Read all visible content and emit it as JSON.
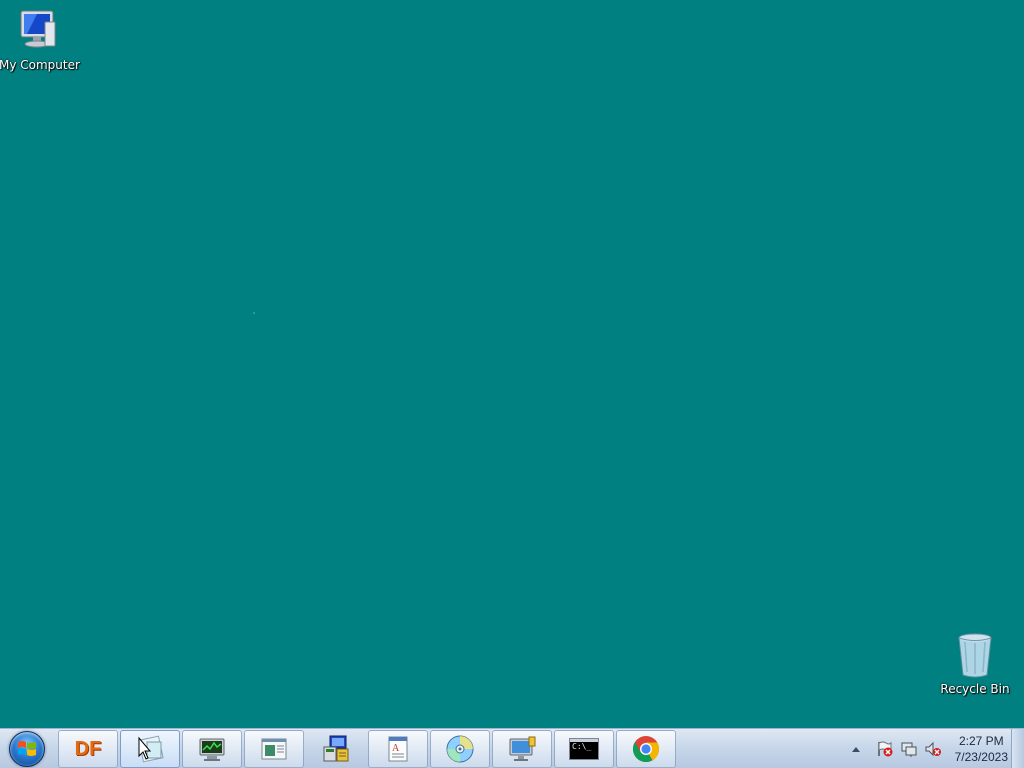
{
  "desktop": {
    "background_color": "#008080",
    "icons": [
      {
        "label": "My Computer",
        "icon": "computer-icon"
      },
      {
        "label": "Recycle Bin",
        "icon": "recycle-bin-icon"
      }
    ]
  },
  "taskbar": {
    "start": {
      "icon": "windows-start-orb-icon"
    },
    "buttons": [
      {
        "text": "DF",
        "icon": "df-app-icon"
      },
      {
        "icon": "cursor-app-icon",
        "active": true
      },
      {
        "icon": "system-monitor-icon"
      },
      {
        "icon": "document-window-icon"
      },
      {
        "icon": "setup-installer-icon"
      },
      {
        "icon": "text-editor-icon"
      },
      {
        "icon": "media-disc-icon"
      },
      {
        "icon": "network-computer-icon"
      },
      {
        "icon": "command-prompt-icon",
        "text": "C:\\_"
      },
      {
        "icon": "chrome-icon"
      }
    ],
    "tray": {
      "icons": [
        "show-hidden-icons-arrow-icon",
        "action-center-flag-icon",
        "network-icon",
        "volume-muted-icon"
      ],
      "time": "2:27 PM",
      "date": "7/23/2023"
    }
  }
}
